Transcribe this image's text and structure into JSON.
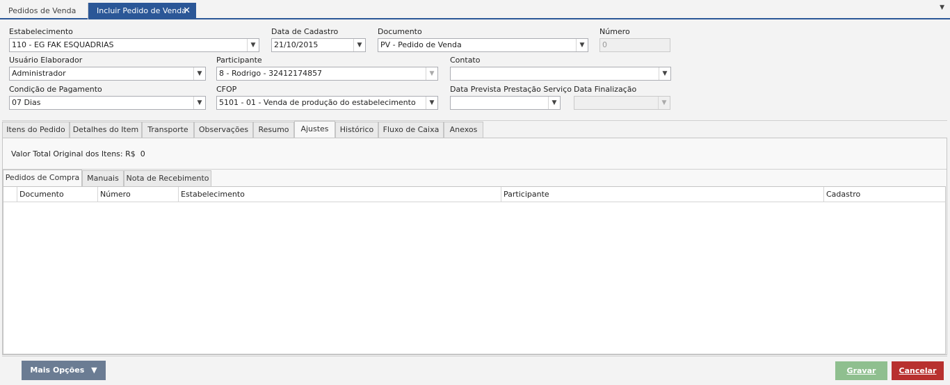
{
  "doc_tabs": [
    {
      "label": "Pedidos de Venda"
    },
    {
      "label": "Incluir Pedido de Venda"
    }
  ],
  "icons": {
    "close": "close-icon",
    "dropdown": "chevron-down-icon"
  },
  "form": {
    "estabelecimento": {
      "label": "Estabelecimento",
      "value": "110 - EG FAK ESQUADRIAS"
    },
    "data_cadastro": {
      "label": "Data de Cadastro",
      "value": "21/10/2015"
    },
    "documento": {
      "label": "Documento",
      "value": "PV - Pedido de Venda"
    },
    "numero": {
      "label": "Número",
      "value": "0"
    },
    "usuario": {
      "label": "Usuário Elaborador",
      "value": "Administrador"
    },
    "participante": {
      "label": "Participante",
      "value": "8 - Rodrigo - 32412174857"
    },
    "contato": {
      "label": "Contato",
      "value": ""
    },
    "condicao": {
      "label": "Condição de Pagamento",
      "value": "07 Dias"
    },
    "cfop": {
      "label": "CFOP",
      "value": "5101 - 01 - Venda de produção do estabelecimento"
    },
    "data_prevista": {
      "label": "Data Prevista Prestação Serviço",
      "value": ""
    },
    "data_finalizacao": {
      "label": "Data Finalização",
      "value": ""
    }
  },
  "tabs": [
    {
      "label": "Itens do Pedido"
    },
    {
      "label": "Detalhes do Item"
    },
    {
      "label": "Transporte"
    },
    {
      "label": "Observações"
    },
    {
      "label": "Resumo"
    },
    {
      "label": "Ajustes"
    },
    {
      "label": "Histórico"
    },
    {
      "label": "Fluxo de Caixa"
    },
    {
      "label": "Anexos"
    }
  ],
  "selected_tab": "Ajustes",
  "total": {
    "label": "Valor Total Original dos Itens:",
    "value": "R$  0"
  },
  "subtabs": [
    {
      "label": "Pedidos de Compra"
    },
    {
      "label": "Manuais"
    },
    {
      "label": "Nota de Recebimento"
    }
  ],
  "grid": {
    "columns": [
      "Documento",
      "Número",
      "Estabelecimento",
      "Participante",
      "Cadastro"
    ],
    "rows": []
  },
  "footer": {
    "more_label": "Mais Opções",
    "more_icon": "▼",
    "save_label": "Gravar",
    "cancel_label": "Cancelar"
  },
  "colors": {
    "accent": "#2b5797",
    "save": "#8fbf8f",
    "cancel": "#b8312f",
    "more": "#6b7c93"
  }
}
